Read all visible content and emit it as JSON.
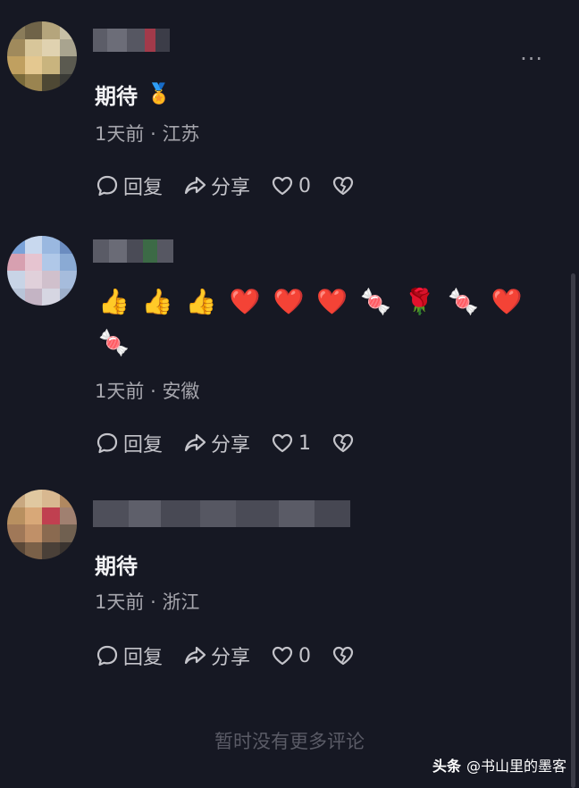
{
  "comments": [
    {
      "text": "期待",
      "text_emoji": "🏅",
      "time": "1天前",
      "location": "江苏",
      "reply_label": "回复",
      "share_label": "分享",
      "likes": "0",
      "has_more_menu": true
    },
    {
      "emojis": [
        "👍",
        "👍",
        "👍",
        "❤️",
        "❤️",
        "❤️",
        "🍬",
        "🌹",
        "🍬",
        "❤️",
        "🍬"
      ],
      "time": "1天前",
      "location": "安徽",
      "reply_label": "回复",
      "share_label": "分享",
      "likes": "1"
    },
    {
      "text": "期待",
      "time": "1天前",
      "location": "浙江",
      "reply_label": "回复",
      "share_label": "分享",
      "likes": "0"
    }
  ],
  "more_menu_glyph": "···",
  "meta_separator": "·",
  "footer": "暂时没有更多评论",
  "watermark": {
    "brand": "头条",
    "handle": "@书山里的墨客"
  },
  "icons": [
    "reply-icon",
    "share-icon",
    "heart-icon",
    "broken-heart-icon",
    "more-icon"
  ],
  "colors": {
    "background": "#161823",
    "text_primary": "#f2f2f4",
    "text_secondary": "#a6a6ad",
    "footer_text": "#5a5b66"
  }
}
